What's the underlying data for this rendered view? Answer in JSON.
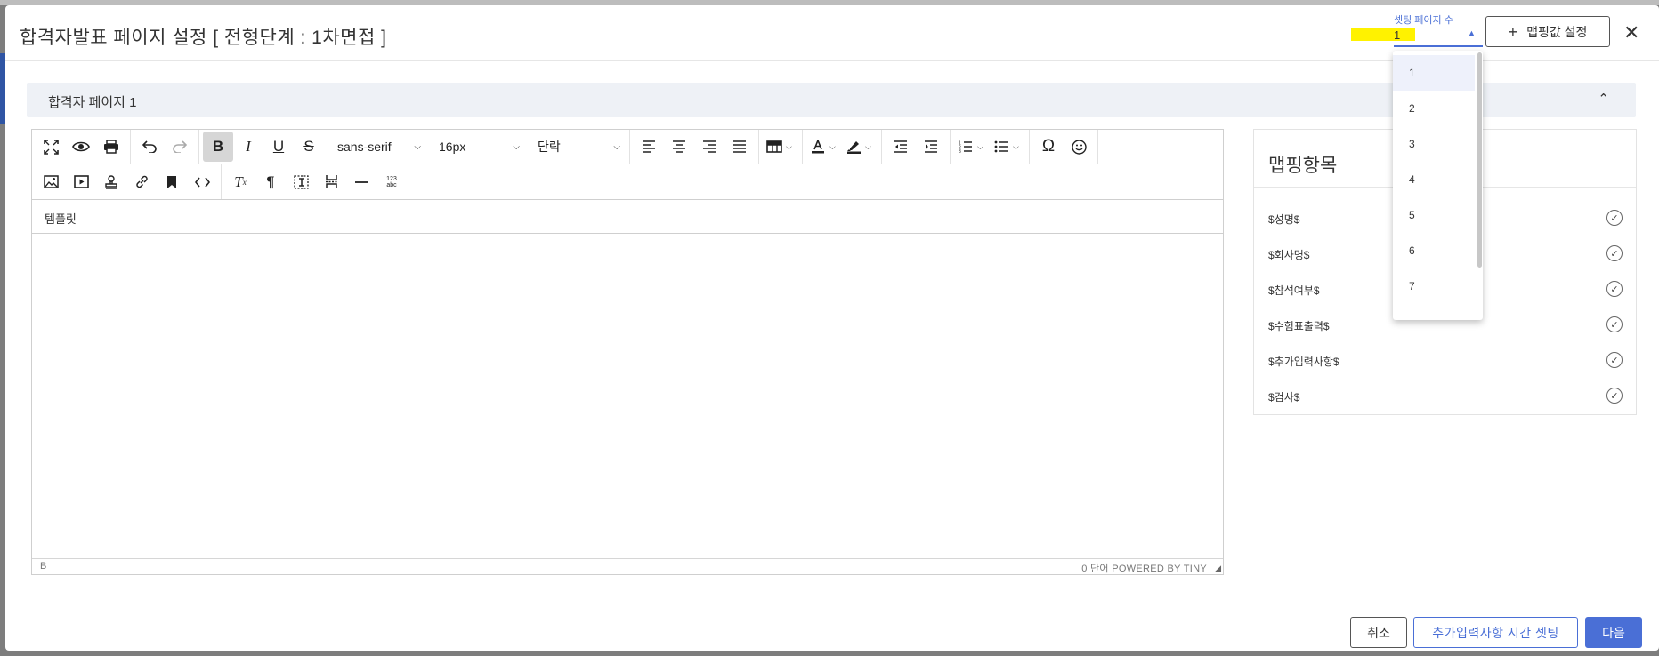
{
  "modal": {
    "title": "합격자발표 페이지 설정 [ 전형단계 : 1차면접 ]",
    "page_count": {
      "label": "셋팅 페이지 수",
      "value": "1"
    },
    "map_button_label": "맵핑값 설정",
    "close_label": "✕"
  },
  "section": {
    "label": "합격자 페이지 1",
    "chevron": "⌃"
  },
  "editor": {
    "font_family": "sans-serif",
    "font_size": "16px",
    "block_format": "단락",
    "mini_toolbar_text": "템플릿",
    "status_path": "B",
    "status_right": "0 단어  POWERED BY TINY"
  },
  "mapping": {
    "title": "맵핑항목",
    "items": [
      "$성명$",
      "$회사명$",
      "$참석여부$",
      "$수험표출력$",
      "$추가입력사항$",
      "$검사$"
    ]
  },
  "dropdown": {
    "options": [
      "1",
      "2",
      "3",
      "4",
      "5",
      "6",
      "7"
    ],
    "selected": "1"
  },
  "footer": {
    "cancel_label": "취소",
    "extra_label": "추가입력사항 시간 셋팅",
    "next_label": "다음"
  },
  "colors": {
    "accent": "#4a6fd6",
    "highlight": "#fff200"
  }
}
